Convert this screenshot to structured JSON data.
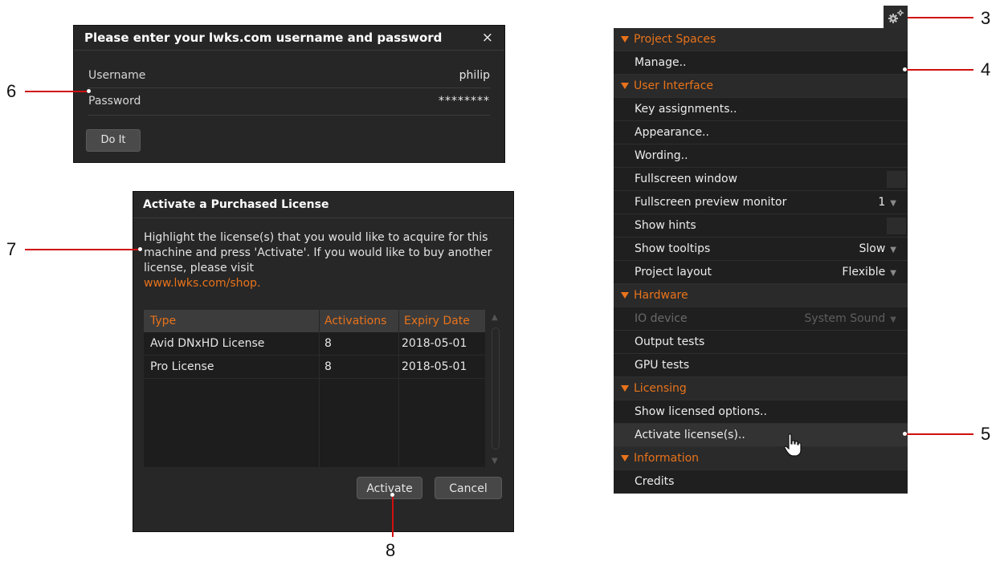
{
  "login_dialog": {
    "title": "Please enter your lwks.com username and password",
    "close_glyph": "×",
    "username_label": "Username",
    "username_value": "philip",
    "password_label": "Password",
    "password_value": "********",
    "submit_label": "Do It"
  },
  "activate_dialog": {
    "title": "Activate a Purchased License",
    "description": "Highlight the license(s) that you would like to acquire for this machine and press 'Activate'.  If you would like to buy another license, please visit",
    "link": "www.lwks.com/shop.",
    "columns": [
      "Type",
      "Activations",
      "Expiry Date"
    ],
    "rows": [
      {
        "type": "Avid DNxHD License",
        "activations": "8",
        "expiry": "2018-05-01"
      },
      {
        "type": "Pro License",
        "activations": "8",
        "expiry": "2018-05-01"
      }
    ],
    "activate_label": "Activate",
    "cancel_label": "Cancel"
  },
  "settings_menu": {
    "icon": "gear-icon",
    "rows": [
      {
        "kind": "section",
        "label": "Project Spaces"
      },
      {
        "kind": "item",
        "label": "Manage.."
      },
      {
        "kind": "section",
        "label": "User Interface"
      },
      {
        "kind": "item",
        "label": "Key assignments.."
      },
      {
        "kind": "item",
        "label": "Appearance.."
      },
      {
        "kind": "item",
        "label": "Wording.."
      },
      {
        "kind": "item",
        "label": "Fullscreen window",
        "control": "checkbox"
      },
      {
        "kind": "item",
        "label": "Fullscreen preview monitor",
        "value": "1",
        "control": "dropdown"
      },
      {
        "kind": "item",
        "label": "Show hints",
        "control": "checkbox"
      },
      {
        "kind": "item",
        "label": "Show tooltips",
        "value": "Slow",
        "control": "dropdown"
      },
      {
        "kind": "item",
        "label": "Project layout",
        "value": "Flexible",
        "control": "dropdown"
      },
      {
        "kind": "section",
        "label": "Hardware"
      },
      {
        "kind": "item",
        "label": "IO device",
        "value": "System Sound",
        "control": "dropdown",
        "disabled": true
      },
      {
        "kind": "item",
        "label": "Output tests"
      },
      {
        "kind": "item",
        "label": "GPU tests"
      },
      {
        "kind": "section",
        "label": "Licensing"
      },
      {
        "kind": "item",
        "label": "Show licensed options.."
      },
      {
        "kind": "item",
        "label": "Activate license(s)..",
        "hover": true
      },
      {
        "kind": "section",
        "label": "Information"
      },
      {
        "kind": "item",
        "label": "Credits"
      }
    ]
  },
  "callouts": {
    "c3": "3",
    "c4": "4",
    "c5": "5",
    "c6": "6",
    "c7": "7",
    "c8": "8"
  },
  "colors": {
    "accent": "#e8731b",
    "leader_line": "#d01010"
  }
}
